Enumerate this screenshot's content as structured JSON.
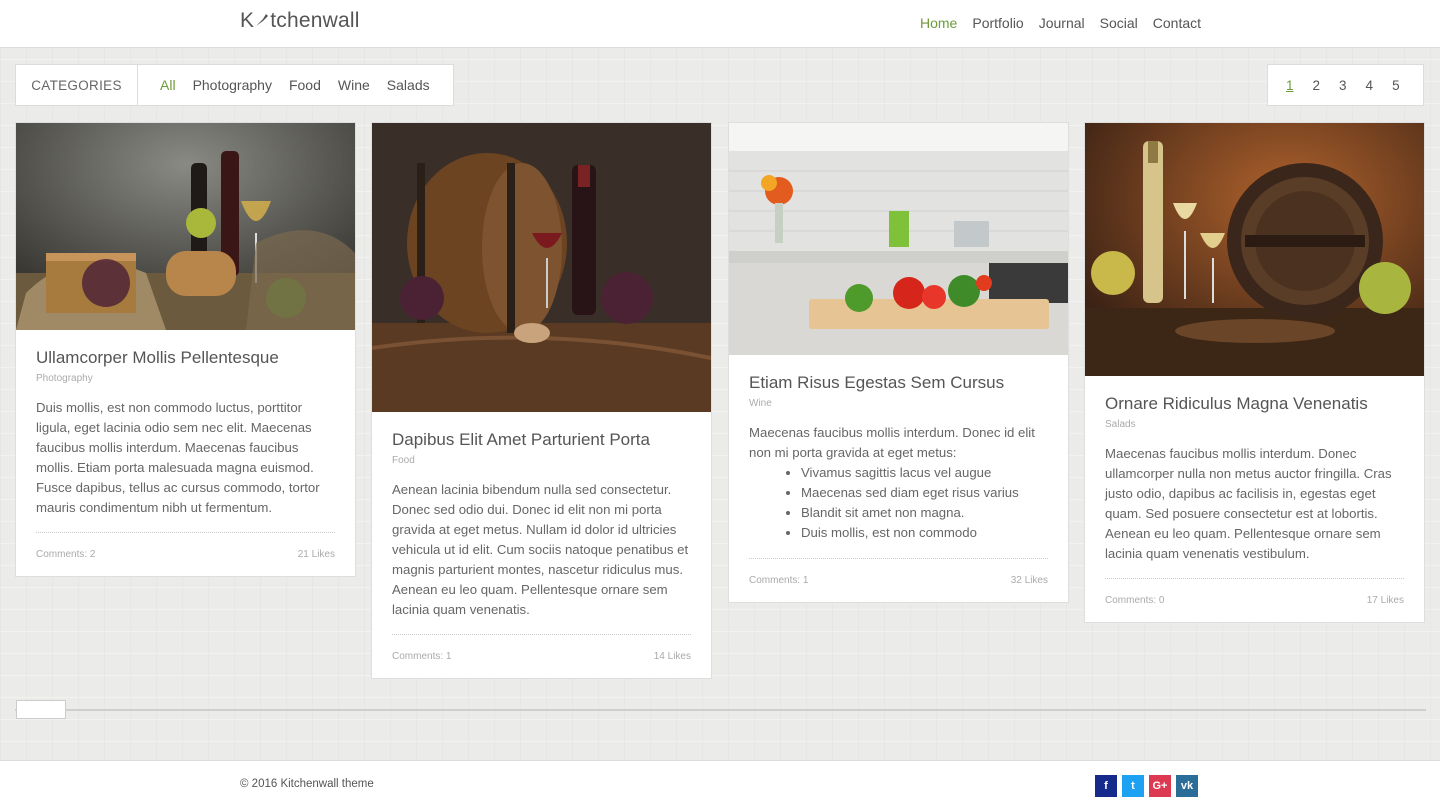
{
  "brand": {
    "logo_prefix": "K",
    "logo_suffix": "tchenwall"
  },
  "nav": {
    "items": [
      {
        "label": "Home",
        "active": true
      },
      {
        "label": "Portfolio"
      },
      {
        "label": "Journal"
      },
      {
        "label": "Social"
      },
      {
        "label": "Contact"
      }
    ]
  },
  "categories": {
    "title": "CATEGORIES",
    "items": [
      "All",
      "Photography",
      "Food",
      "Wine",
      "Salads"
    ],
    "active": "All"
  },
  "pagination": {
    "pages": [
      "1",
      "2",
      "3",
      "4",
      "5"
    ],
    "current": "1"
  },
  "colors": {
    "accent": "#6e9b3a",
    "facebook": "#3b5998",
    "twitter": "#1da1f2",
    "googleplus": "#dc4a38",
    "vk": "#45668e"
  },
  "posts": [
    {
      "title": "Ullamcorper Mollis Pellentesque",
      "category": "Photography",
      "text": "Duis mollis, est non commodo luctus, porttitor ligula, eget lacinia odio sem nec elit. Maecenas faucibus mollis interdum. Maecenas faucibus mollis. Etiam porta malesuada magna euismod. Fusce dapibus, tellus ac cursus commodo, tortor mauris condimentum nibh ut fermentum.",
      "comments": "Comments: 2",
      "likes": "21 Likes",
      "image": "wine-still-life"
    },
    {
      "title": "Dapibus Elit Amet Parturient Porta",
      "category": "Food",
      "text": "Aenean lacinia bibendum nulla sed consectetur. Donec sed odio dui. Donec id elit non mi porta gravida at eget metus. Nullam id dolor id ultricies vehicula ut id elit. Cum sociis natoque penatibus et magnis parturient montes, nascetur ridiculus mus. Aenean eu leo quam. Pellentesque ornare sem lacinia quam venenatis.",
      "comments": "Comments: 1",
      "likes": "14 Likes",
      "image": "wine-barrel"
    },
    {
      "title": "Etiam Risus Egestas Sem Cursus",
      "category": "Wine",
      "text": "Maecenas faucibus mollis interdum. Donec id elit non mi porta gravida at eget metus:",
      "list": [
        "Vivamus sagittis lacus vel augue",
        "Maecenas sed diam eget risus varius",
        "Blandit sit amet non magna.",
        "Duis mollis, est non commodo"
      ],
      "comments": "Comments: 1",
      "likes": "32 Likes",
      "image": "kitchen-vegetables"
    },
    {
      "title": "Ornare Ridiculus Magna Venenatis",
      "category": "Salads",
      "text": "Maecenas faucibus mollis interdum. Donec ullamcorper nulla non metus auctor fringilla. Cras justo odio, dapibus ac facilisis in, egestas eget quam. Sed posuere consectetur est at lobortis. Aenean eu leo quam. Pellentesque ornare sem lacinia quam venenatis vestibulum.",
      "comments": "Comments: 0",
      "likes": "17 Likes",
      "image": "barrel-white-wine"
    }
  ],
  "footer": {
    "copyright": "© 2016 Kitchenwall theme",
    "socials": [
      {
        "name": "facebook-icon",
        "glyph": "f"
      },
      {
        "name": "twitter-icon",
        "glyph": "t"
      },
      {
        "name": "google-plus-icon",
        "glyph": "G+"
      },
      {
        "name": "vk-icon",
        "glyph": "vk"
      }
    ]
  }
}
